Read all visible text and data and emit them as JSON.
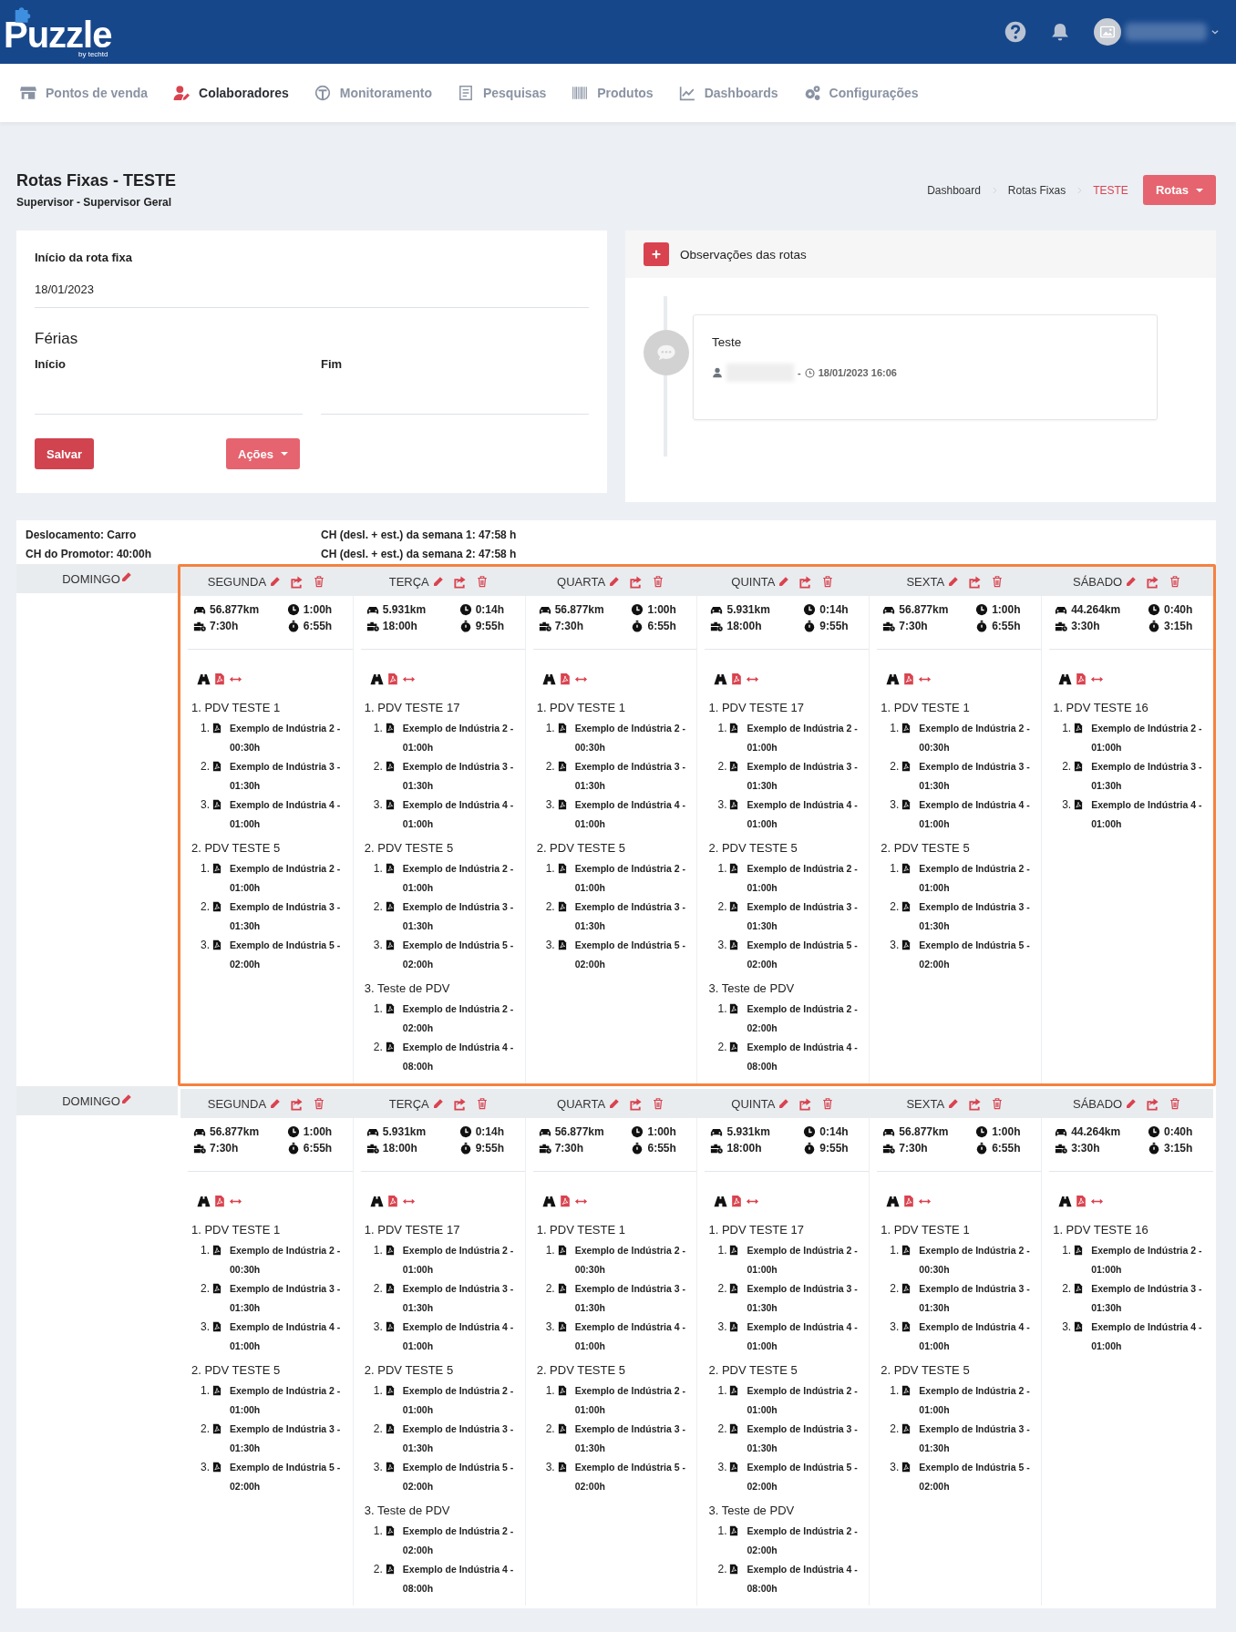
{
  "header": {
    "logo": "Puzzle",
    "logo_tagline": "by techtd"
  },
  "nav": [
    {
      "label": "Pontos de venda",
      "selected": false
    },
    {
      "label": "Colaboradores",
      "selected": true
    },
    {
      "label": "Monitoramento",
      "selected": false
    },
    {
      "label": "Pesquisas",
      "selected": false
    },
    {
      "label": "Produtos",
      "selected": false
    },
    {
      "label": "Dashboards",
      "selected": false
    },
    {
      "label": "Configurações",
      "selected": false
    }
  ],
  "page": {
    "title": "Rotas Fixas - ",
    "title_strong": "TESTE",
    "subtitle": "Supervisor - Supervisor Geral"
  },
  "breadcrumb": [
    {
      "label": "Dashboard",
      "current": false
    },
    {
      "label": "Rotas Fixas",
      "current": false
    },
    {
      "label": "TESTE",
      "current": true
    }
  ],
  "rotas_button": "Rotas",
  "form": {
    "start_label": "Início da rota fixa",
    "start_value": "18/01/2023",
    "vacation_title": "Férias",
    "vacation_start_label": "Início",
    "vacation_end_label": "Fim",
    "save_button": "Salvar",
    "actions_button": "Ações"
  },
  "observations": {
    "title": "Observações das rotas",
    "entries": [
      {
        "text": "Teste",
        "separator": "-",
        "datetime": "18/01/2023 16:06"
      }
    ]
  },
  "summary": {
    "transport": "Deslocamento: Carro",
    "promoter_hours": "CH do Promotor: 40:00h",
    "week_hours": [
      "CH (desl. + est.) da semana 1: 47:58 h",
      "CH (desl. + est.) da semana 2: 47:58 h"
    ]
  },
  "weeks": [
    {
      "highlighted": true,
      "days": [
        {
          "name": "DOMINGO",
          "kind": "empty"
        },
        {
          "name": "SEGUNDA",
          "kind": "route",
          "distance": "56.877km",
          "clock_time": "1:00h",
          "work_time": "7:30h",
          "stopwatch_time": "6:55h",
          "pdvs": [
            {
              "title": "1. PDV TESTE 1",
              "items": [
                {
                  "num": "1.",
                  "text": "Exemplo de Indústria 2 - 00:30h"
                },
                {
                  "num": "2.",
                  "text": "Exemplo de Indústria 3 - 01:30h"
                },
                {
                  "num": "3.",
                  "text": "Exemplo de Indústria 4 - 01:00h"
                }
              ]
            },
            {
              "title": "2. PDV TESTE 5",
              "items": [
                {
                  "num": "1.",
                  "text": "Exemplo de Indústria 2 - 01:00h"
                },
                {
                  "num": "2.",
                  "text": "Exemplo de Indústria 3 - 01:30h"
                },
                {
                  "num": "3.",
                  "text": "Exemplo de Indústria 5 - 02:00h"
                }
              ]
            }
          ]
        },
        {
          "name": "TERÇA",
          "kind": "route",
          "distance": "5.931km",
          "clock_time": "0:14h",
          "work_time": "18:00h",
          "stopwatch_time": "9:55h",
          "pdvs": [
            {
              "title": "1. PDV TESTE 17",
              "items": [
                {
                  "num": "1.",
                  "text": "Exemplo de Indústria 2 - 01:00h"
                },
                {
                  "num": "2.",
                  "text": "Exemplo de Indústria 3 - 01:30h"
                },
                {
                  "num": "3.",
                  "text": "Exemplo de Indústria 4 - 01:00h"
                }
              ]
            },
            {
              "title": "2. PDV TESTE 5",
              "items": [
                {
                  "num": "1.",
                  "text": "Exemplo de Indústria 2 - 01:00h"
                },
                {
                  "num": "2.",
                  "text": "Exemplo de Indústria 3 - 01:30h"
                },
                {
                  "num": "3.",
                  "text": "Exemplo de Indústria 5 - 02:00h"
                }
              ]
            },
            {
              "title": "3. Teste de PDV",
              "items": [
                {
                  "num": "1.",
                  "text": "Exemplo de Indústria 2 - 02:00h"
                },
                {
                  "num": "2.",
                  "text": "Exemplo de Indústria 4 - 08:00h"
                }
              ]
            }
          ]
        },
        {
          "name": "QUARTA",
          "kind": "route",
          "distance": "56.877km",
          "clock_time": "1:00h",
          "work_time": "7:30h",
          "stopwatch_time": "6:55h",
          "pdvs": [
            {
              "title": "1. PDV TESTE 1",
              "items": [
                {
                  "num": "1.",
                  "text": "Exemplo de Indústria 2 - 00:30h"
                },
                {
                  "num": "2.",
                  "text": "Exemplo de Indústria 3 - 01:30h"
                },
                {
                  "num": "3.",
                  "text": "Exemplo de Indústria 4 - 01:00h"
                }
              ]
            },
            {
              "title": "2. PDV TESTE 5",
              "items": [
                {
                  "num": "1.",
                  "text": "Exemplo de Indústria 2 - 01:00h"
                },
                {
                  "num": "2.",
                  "text": "Exemplo de Indústria 3 - 01:30h"
                },
                {
                  "num": "3.",
                  "text": "Exemplo de Indústria 5 - 02:00h"
                }
              ]
            }
          ]
        },
        {
          "name": "QUINTA",
          "kind": "route",
          "distance": "5.931km",
          "clock_time": "0:14h",
          "work_time": "18:00h",
          "stopwatch_time": "9:55h",
          "pdvs": [
            {
              "title": "1. PDV TESTE 17",
              "items": [
                {
                  "num": "1.",
                  "text": "Exemplo de Indústria 2 - 01:00h"
                },
                {
                  "num": "2.",
                  "text": "Exemplo de Indústria 3 - 01:30h"
                },
                {
                  "num": "3.",
                  "text": "Exemplo de Indústria 4 - 01:00h"
                }
              ]
            },
            {
              "title": "2. PDV TESTE 5",
              "items": [
                {
                  "num": "1.",
                  "text": "Exemplo de Indústria 2 - 01:00h"
                },
                {
                  "num": "2.",
                  "text": "Exemplo de Indústria 3 - 01:30h"
                },
                {
                  "num": "3.",
                  "text": "Exemplo de Indústria 5 - 02:00h"
                }
              ]
            },
            {
              "title": "3. Teste de PDV",
              "items": [
                {
                  "num": "1.",
                  "text": "Exemplo de Indústria 2 - 02:00h"
                },
                {
                  "num": "2.",
                  "text": "Exemplo de Indústria 4 - 08:00h"
                }
              ]
            }
          ]
        },
        {
          "name": "SEXTA",
          "kind": "route",
          "distance": "56.877km",
          "clock_time": "1:00h",
          "work_time": "7:30h",
          "stopwatch_time": "6:55h",
          "pdvs": [
            {
              "title": "1. PDV TESTE 1",
              "items": [
                {
                  "num": "1.",
                  "text": "Exemplo de Indústria 2 - 00:30h"
                },
                {
                  "num": "2.",
                  "text": "Exemplo de Indústria 3 - 01:30h"
                },
                {
                  "num": "3.",
                  "text": "Exemplo de Indústria 4 - 01:00h"
                }
              ]
            },
            {
              "title": "2. PDV TESTE 5",
              "items": [
                {
                  "num": "1.",
                  "text": "Exemplo de Indústria 2 - 01:00h"
                },
                {
                  "num": "2.",
                  "text": "Exemplo de Indústria 3 - 01:30h"
                },
                {
                  "num": "3.",
                  "text": "Exemplo de Indústria 5 - 02:00h"
                }
              ]
            }
          ]
        },
        {
          "name": "SÁBADO",
          "kind": "route",
          "distance": "44.264km",
          "clock_time": "0:40h",
          "work_time": "3:30h",
          "stopwatch_time": "3:15h",
          "pdvs": [
            {
              "title": "1. PDV TESTE 16",
              "items": [
                {
                  "num": "1.",
                  "text": "Exemplo de Indústria 2 - 01:00h"
                },
                {
                  "num": "2.",
                  "text": "Exemplo de Indústria 3 - 01:30h"
                },
                {
                  "num": "3.",
                  "text": "Exemplo de Indústria 4 - 01:00h"
                }
              ]
            }
          ]
        }
      ]
    },
    {
      "highlighted": false,
      "days": [
        {
          "name": "DOMINGO",
          "kind": "empty"
        },
        {
          "name": "SEGUNDA",
          "kind": "route",
          "distance": "56.877km",
          "clock_time": "1:00h",
          "work_time": "7:30h",
          "stopwatch_time": "6:55h",
          "pdvs": [
            {
              "title": "1. PDV TESTE 1",
              "items": [
                {
                  "num": "1.",
                  "text": "Exemplo de Indústria 2 - 00:30h"
                },
                {
                  "num": "2.",
                  "text": "Exemplo de Indústria 3 - 01:30h"
                },
                {
                  "num": "3.",
                  "text": "Exemplo de Indústria 4 - 01:00h"
                }
              ]
            },
            {
              "title": "2. PDV TESTE 5",
              "items": [
                {
                  "num": "1.",
                  "text": "Exemplo de Indústria 2 - 01:00h"
                },
                {
                  "num": "2.",
                  "text": "Exemplo de Indústria 3 - 01:30h"
                },
                {
                  "num": "3.",
                  "text": "Exemplo de Indústria 5 - 02:00h"
                }
              ]
            }
          ]
        },
        {
          "name": "TERÇA",
          "kind": "route",
          "distance": "5.931km",
          "clock_time": "0:14h",
          "work_time": "18:00h",
          "stopwatch_time": "9:55h",
          "pdvs": [
            {
              "title": "1. PDV TESTE 17",
              "items": [
                {
                  "num": "1.",
                  "text": "Exemplo de Indústria 2 - 01:00h"
                },
                {
                  "num": "2.",
                  "text": "Exemplo de Indústria 3 - 01:30h"
                },
                {
                  "num": "3.",
                  "text": "Exemplo de Indústria 4 - 01:00h"
                }
              ]
            },
            {
              "title": "2. PDV TESTE 5",
              "items": [
                {
                  "num": "1.",
                  "text": "Exemplo de Indústria 2 - 01:00h"
                },
                {
                  "num": "2.",
                  "text": "Exemplo de Indústria 3 - 01:30h"
                },
                {
                  "num": "3.",
                  "text": "Exemplo de Indústria 5 - 02:00h"
                }
              ]
            },
            {
              "title": "3. Teste de PDV",
              "items": [
                {
                  "num": "1.",
                  "text": "Exemplo de Indústria 2 - 02:00h"
                },
                {
                  "num": "2.",
                  "text": "Exemplo de Indústria 4 - 08:00h"
                }
              ]
            }
          ]
        },
        {
          "name": "QUARTA",
          "kind": "route",
          "distance": "56.877km",
          "clock_time": "1:00h",
          "work_time": "7:30h",
          "stopwatch_time": "6:55h",
          "pdvs": [
            {
              "title": "1. PDV TESTE 1",
              "items": [
                {
                  "num": "1.",
                  "text": "Exemplo de Indústria 2 - 00:30h"
                },
                {
                  "num": "2.",
                  "text": "Exemplo de Indústria 3 - 01:30h"
                },
                {
                  "num": "3.",
                  "text": "Exemplo de Indústria 4 - 01:00h"
                }
              ]
            },
            {
              "title": "2. PDV TESTE 5",
              "items": [
                {
                  "num": "1.",
                  "text": "Exemplo de Indústria 2 - 01:00h"
                },
                {
                  "num": "2.",
                  "text": "Exemplo de Indústria 3 - 01:30h"
                },
                {
                  "num": "3.",
                  "text": "Exemplo de Indústria 5 - 02:00h"
                }
              ]
            }
          ]
        },
        {
          "name": "QUINTA",
          "kind": "route",
          "distance": "5.931km",
          "clock_time": "0:14h",
          "work_time": "18:00h",
          "stopwatch_time": "9:55h",
          "pdvs": [
            {
              "title": "1. PDV TESTE 17",
              "items": [
                {
                  "num": "1.",
                  "text": "Exemplo de Indústria 2 - 01:00h"
                },
                {
                  "num": "2.",
                  "text": "Exemplo de Indústria 3 - 01:30h"
                },
                {
                  "num": "3.",
                  "text": "Exemplo de Indústria 4 - 01:00h"
                }
              ]
            },
            {
              "title": "2. PDV TESTE 5",
              "items": [
                {
                  "num": "1.",
                  "text": "Exemplo de Indústria 2 - 01:00h"
                },
                {
                  "num": "2.",
                  "text": "Exemplo de Indústria 3 - 01:30h"
                },
                {
                  "num": "3.",
                  "text": "Exemplo de Indústria 5 - 02:00h"
                }
              ]
            },
            {
              "title": "3. Teste de PDV",
              "items": [
                {
                  "num": "1.",
                  "text": "Exemplo de Indústria 2 - 02:00h"
                },
                {
                  "num": "2.",
                  "text": "Exemplo de Indústria 4 - 08:00h"
                }
              ]
            }
          ]
        },
        {
          "name": "SEXTA",
          "kind": "route",
          "distance": "56.877km",
          "clock_time": "1:00h",
          "work_time": "7:30h",
          "stopwatch_time": "6:55h",
          "pdvs": [
            {
              "title": "1. PDV TESTE 1",
              "items": [
                {
                  "num": "1.",
                  "text": "Exemplo de Indústria 2 - 00:30h"
                },
                {
                  "num": "2.",
                  "text": "Exemplo de Indústria 3 - 01:30h"
                },
                {
                  "num": "3.",
                  "text": "Exemplo de Indústria 4 - 01:00h"
                }
              ]
            },
            {
              "title": "2. PDV TESTE 5",
              "items": [
                {
                  "num": "1.",
                  "text": "Exemplo de Indústria 2 - 01:00h"
                },
                {
                  "num": "2.",
                  "text": "Exemplo de Indústria 3 - 01:30h"
                },
                {
                  "num": "3.",
                  "text": "Exemplo de Indústria 5 - 02:00h"
                }
              ]
            }
          ]
        },
        {
          "name": "SÁBADO",
          "kind": "route",
          "distance": "44.264km",
          "clock_time": "0:40h",
          "work_time": "3:30h",
          "stopwatch_time": "3:15h",
          "pdvs": [
            {
              "title": "1. PDV TESTE 16",
              "items": [
                {
                  "num": "1.",
                  "text": "Exemplo de Indústria 2 - 01:00h"
                },
                {
                  "num": "2.",
                  "text": "Exemplo de Indústria 3 - 01:30h"
                },
                {
                  "num": "3.",
                  "text": "Exemplo de Indústria 4 - 01:00h"
                }
              ]
            }
          ]
        }
      ]
    }
  ]
}
